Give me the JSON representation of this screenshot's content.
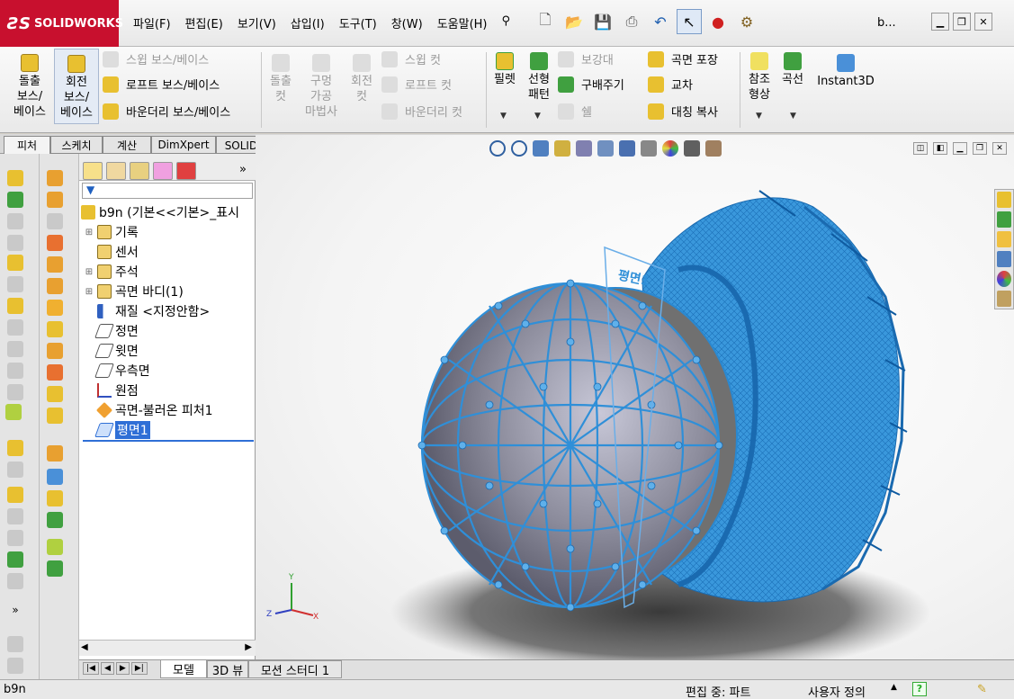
{
  "app": {
    "brand": "SOLIDWORKS",
    "window_title": "b..."
  },
  "menu": [
    "파일(F)",
    "편집(E)",
    "보기(V)",
    "삽입(I)",
    "도구(T)",
    "창(W)",
    "도움말(H)"
  ],
  "quick_tools": [
    "new-icon",
    "open-icon",
    "save-icon",
    "print-icon",
    "undo-icon",
    "select-icon",
    "rebuild-icon",
    "options-icon"
  ],
  "ribbon": {
    "extrude_boss": "돌출\n보스/\n베이스",
    "revolve_boss": "회전\n보스/\n베이스",
    "sweep_boss": "스윕 보스/베이스",
    "loft_boss": "로프트 보스/베이스",
    "boundary_boss": "바운더리 보스/베이스",
    "extrude_cut": "돌출\n컷",
    "hole_wizard": "구멍\n가공\n마법사",
    "revolve_cut": "회전\n컷",
    "sweep_cut": "스윕 컷",
    "loft_cut": "로프트 컷",
    "boundary_cut": "바운더리 컷",
    "fillet": "필렛",
    "linear_pattern": "선형\n패턴",
    "rib": "보강대",
    "draft": "구배주기",
    "shell": "쉘",
    "wrap": "곡면 포장",
    "intersect": "교차",
    "mirror": "대칭 복사",
    "ref_geometry": "참조\n형상",
    "curves": "곡선",
    "instant3d": "Instant3D"
  },
  "cm_tabs": [
    "피처",
    "스케치",
    "계산",
    "DimXpert",
    "SOLIDWORKS 애드인"
  ],
  "tree": {
    "root": "b9n  (기본<<기본>_표시",
    "items": [
      "기록",
      "센서",
      "주석",
      "곡면 바디(1)",
      "재질 <지정안함>",
      "정면",
      "윗면",
      "우측면",
      "원점",
      "곡면-불러온 피처1",
      "평면1"
    ]
  },
  "plane_label": "평면1",
  "triad": {
    "x": "X",
    "y": "Y",
    "z": "Z"
  },
  "bottom_tabs": [
    "모델",
    "3D 뷰",
    "모션 스터디 1"
  ],
  "status": {
    "doc": "b9n",
    "mode": "편집 중: 파트",
    "units": "사용자 정의",
    "help": "?"
  },
  "colors": {
    "mesh": "#2f8fd8",
    "brand": "#c8102e",
    "selected": "#2f6fd6"
  }
}
